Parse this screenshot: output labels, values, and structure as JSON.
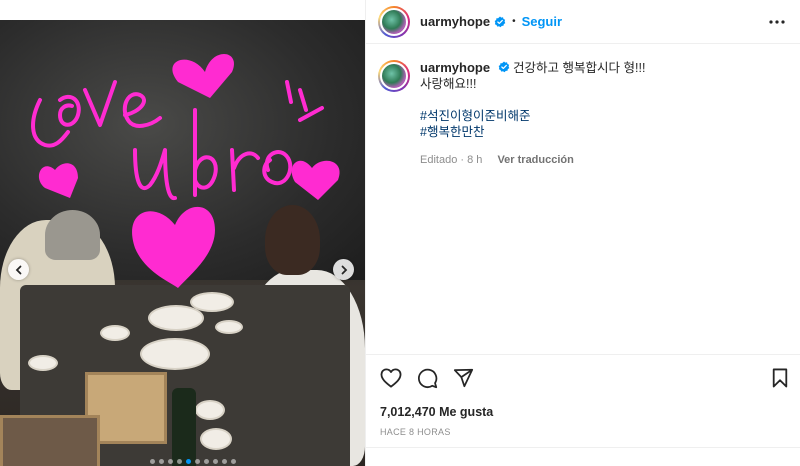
{
  "post": {
    "username": "uarmyhope",
    "follow_label": "Seguir",
    "separator": "•",
    "caption_line1": "건강하고 행복합시다 형!!!",
    "caption_line2": "사랑해요!!!",
    "hashtags": [
      "#석진이형이준비해준",
      "#행복한만찬"
    ],
    "edited_label": "Editado · 8 h",
    "translate_label": "Ver traducción",
    "likes_label": "7,012,470 Me gusta",
    "time_label": "HACE 8 HORAS"
  },
  "media": {
    "doodle_text_1": "Love",
    "doodle_text_2": "u bro",
    "carousel_total": 10,
    "carousel_active": 5
  },
  "colors": {
    "accent": "#0095f6",
    "hashtag": "#00376b",
    "doodle": "#ff2bd1",
    "muted": "#8e8e8e"
  },
  "icons": {
    "verified": "verified-badge-icon",
    "more": "more-horizontal-icon",
    "like": "heart-icon",
    "comment": "comment-icon",
    "share": "paper-plane-icon",
    "save": "bookmark-icon",
    "prev": "chevron-left-icon",
    "next": "chevron-right-icon"
  }
}
